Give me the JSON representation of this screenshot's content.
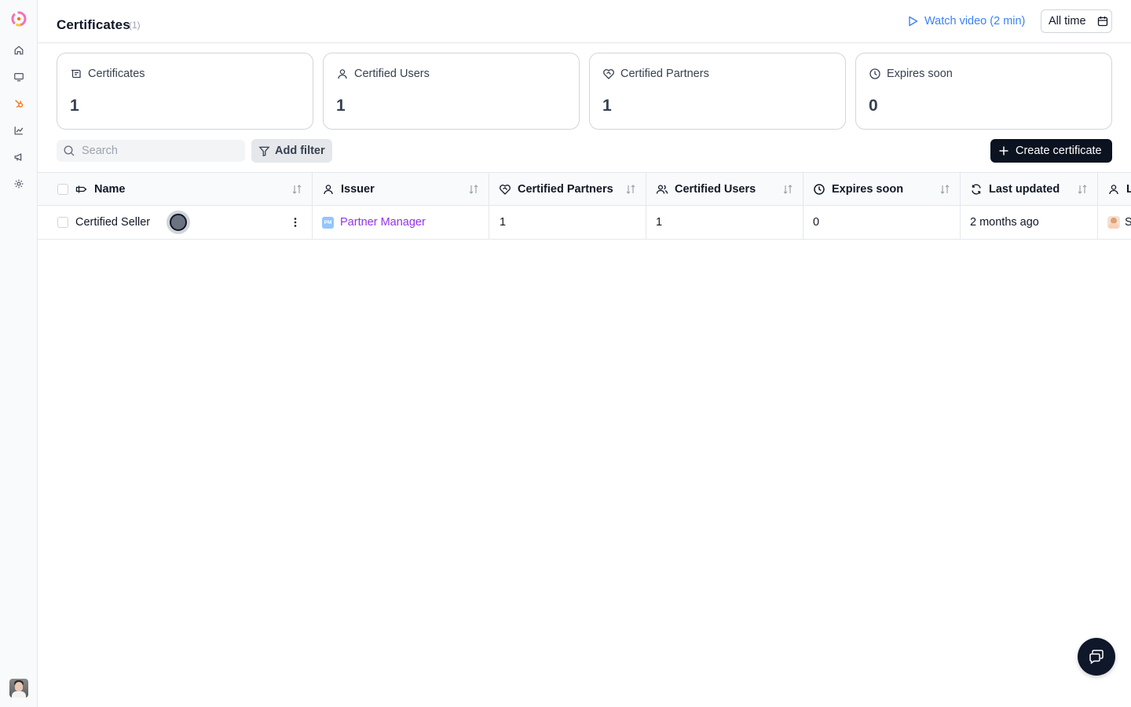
{
  "header": {
    "title": "Certificates",
    "count": "(1)",
    "watch_video": "Watch video (2 min)",
    "time_range": "All time"
  },
  "stats": [
    {
      "label": "Certificates",
      "value": "1",
      "icon": "certificate-icon"
    },
    {
      "label": "Certified Users",
      "value": "1",
      "icon": "user-icon"
    },
    {
      "label": "Certified Partners",
      "value": "1",
      "icon": "handshake-heart-icon"
    },
    {
      "label": "Expires soon",
      "value": "0",
      "icon": "clock-icon"
    }
  ],
  "toolbar": {
    "search_placeholder": "Search",
    "add_filter": "Add filter",
    "create": "Create certificate"
  },
  "table": {
    "columns": [
      "Name",
      "Issuer",
      "Certified Partners",
      "Certified Users",
      "Expires soon",
      "Last updated",
      "L"
    ],
    "rows": [
      {
        "name": "Certified Seller",
        "issuer_badge": "PM",
        "issuer": "Partner Manager",
        "certified_partners": "1",
        "certified_users": "1",
        "expires_soon": "0",
        "last_updated": "2 months ago",
        "last_col": "S"
      }
    ]
  },
  "colors": {
    "accent_blue": "#3b82f6",
    "issuer_purple": "#9333ea",
    "primary_dark": "#0b1220"
  }
}
